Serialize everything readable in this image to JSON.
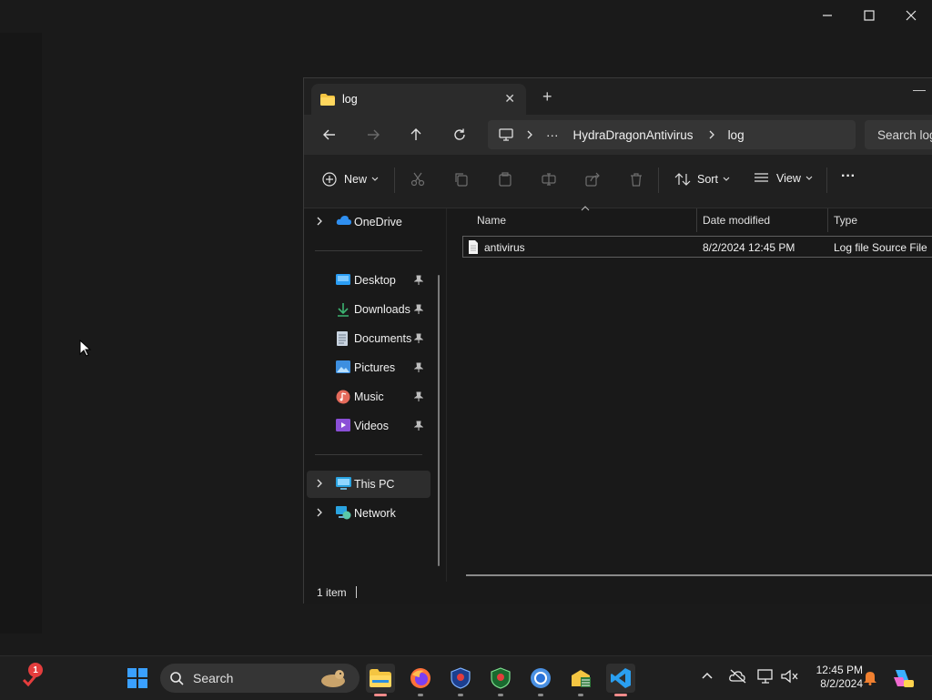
{
  "background_window": {
    "controls": [
      "minimize",
      "maximize",
      "close"
    ]
  },
  "explorer": {
    "tab_title": "log",
    "address": {
      "ellipsis": "···",
      "segments": [
        "HydraDragonAntivirus",
        "log"
      ]
    },
    "search_placeholder": "Search log",
    "toolbar": {
      "new_label": "New",
      "sort_label": "Sort",
      "view_label": "View",
      "more_label": "···"
    },
    "nav": {
      "onedrive": "OneDrive",
      "quick_access": [
        {
          "label": "Desktop",
          "icon": "desktop-icon"
        },
        {
          "label": "Downloads",
          "icon": "download-icon"
        },
        {
          "label": "Documents",
          "icon": "document-icon"
        },
        {
          "label": "Pictures",
          "icon": "pictures-icon"
        },
        {
          "label": "Music",
          "icon": "music-icon"
        },
        {
          "label": "Videos",
          "icon": "videos-icon"
        }
      ],
      "this_pc": "This PC",
      "network": "Network"
    },
    "columns": {
      "name": "Name",
      "date_modified": "Date modified",
      "type": "Type"
    },
    "files": [
      {
        "name": "antivirus",
        "date_modified": "8/2/2024 12:45 PM",
        "type": "Log file Source File"
      }
    ],
    "status": "1 item"
  },
  "taskbar": {
    "search_label": "Search",
    "notification_badge": "1",
    "clock_time": "12:45 PM",
    "clock_date": "8/2/2024",
    "apps": [
      "file-explorer",
      "firefox",
      "shield-app",
      "shield-app-2",
      "chrome",
      "network-app",
      "vscode"
    ]
  },
  "colors": {
    "background": "#181818",
    "explorer_bg": "#191919",
    "accent_folder": "#f4c542",
    "taskbar": "#1f1f1f"
  }
}
